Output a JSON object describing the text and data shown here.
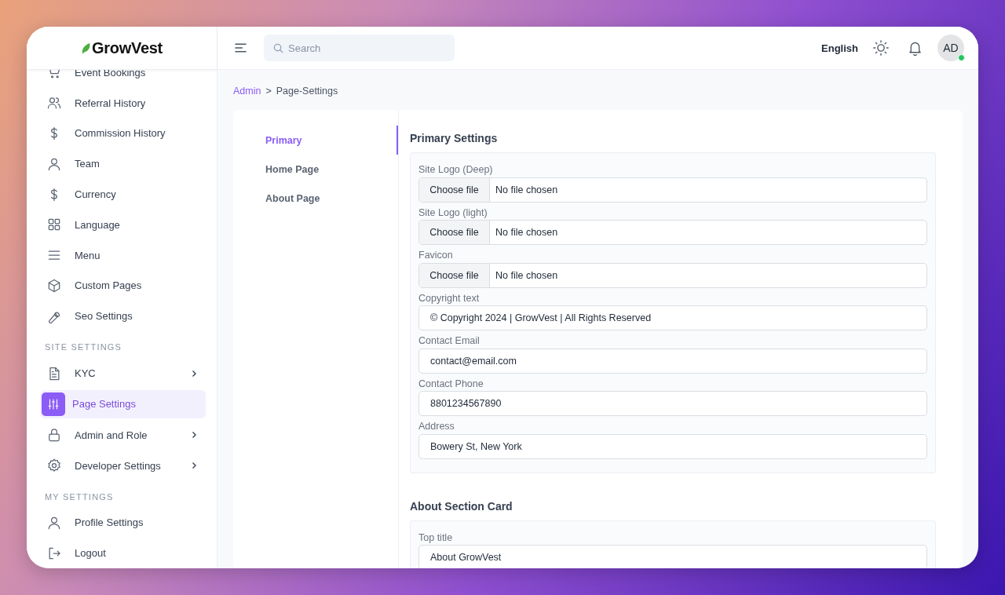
{
  "brand": {
    "name": "GrowVest"
  },
  "sidebar": {
    "items": [
      {
        "kind": "item",
        "label": "Event Bookings",
        "selected": false,
        "submenu": false
      },
      {
        "kind": "item",
        "label": "Referral History",
        "selected": false,
        "submenu": false
      },
      {
        "kind": "item",
        "label": "Commission History",
        "selected": false,
        "submenu": false
      },
      {
        "kind": "item",
        "label": "Team",
        "selected": false,
        "submenu": false
      },
      {
        "kind": "item",
        "label": "Currency",
        "selected": false,
        "submenu": false
      },
      {
        "kind": "item",
        "label": "Language",
        "selected": false,
        "submenu": false
      },
      {
        "kind": "item",
        "label": "Menu",
        "selected": false,
        "submenu": false
      },
      {
        "kind": "item",
        "label": "Custom Pages",
        "selected": false,
        "submenu": false
      },
      {
        "kind": "item",
        "label": "Seo Settings",
        "selected": false,
        "submenu": false
      },
      {
        "kind": "section",
        "label": "SITE SETTINGS"
      },
      {
        "kind": "item",
        "label": "KYC",
        "selected": false,
        "submenu": true
      },
      {
        "kind": "item",
        "label": "Page Settings",
        "selected": true,
        "submenu": false
      },
      {
        "kind": "item",
        "label": "Admin and Role",
        "selected": false,
        "submenu": true
      },
      {
        "kind": "item",
        "label": "Developer Settings",
        "selected": false,
        "submenu": true
      },
      {
        "kind": "section",
        "label": "MY SETTINGS"
      },
      {
        "kind": "item",
        "label": "Profile Settings",
        "selected": false,
        "submenu": false
      },
      {
        "kind": "item",
        "label": "Logout",
        "selected": false,
        "submenu": false
      }
    ]
  },
  "topbar": {
    "search": {
      "placeholder": "Search"
    },
    "language": "English",
    "avatar": {
      "initials": "AD",
      "online": true
    }
  },
  "breadcrumb": [
    {
      "label": "Admin",
      "link": true
    },
    {
      "label": ">",
      "link": false
    },
    {
      "label": "Page-Settings",
      "link": false
    }
  ],
  "tabs": [
    {
      "label": "Primary",
      "selected": true
    },
    {
      "label": "Home Page",
      "selected": false
    },
    {
      "label": "About Page",
      "selected": false
    }
  ],
  "sections": [
    {
      "title": "Primary Settings",
      "fields": [
        {
          "kind": "file",
          "label": "Site Logo (Deep)",
          "button": "Choose file",
          "status": "No file chosen"
        },
        {
          "kind": "file",
          "label": "Site Logo (light)",
          "button": "Choose file",
          "status": "No file chosen"
        },
        {
          "kind": "file",
          "label": "Favicon",
          "button": "Choose file",
          "status": "No file chosen"
        },
        {
          "kind": "text",
          "label": "Copyright text",
          "value": "© Copyright 2024 | GrowVest | All Rights Reserved"
        },
        {
          "kind": "text",
          "label": "Contact Email",
          "value": "contact@email.com"
        },
        {
          "kind": "text",
          "label": "Contact Phone",
          "value": "8801234567890"
        },
        {
          "kind": "text",
          "label": "Address",
          "value": "Bowery St, New York"
        }
      ]
    },
    {
      "title": "About Section Card",
      "fields": [
        {
          "kind": "text",
          "label": "Top title",
          "value": "About GrowVest"
        }
      ]
    }
  ]
}
